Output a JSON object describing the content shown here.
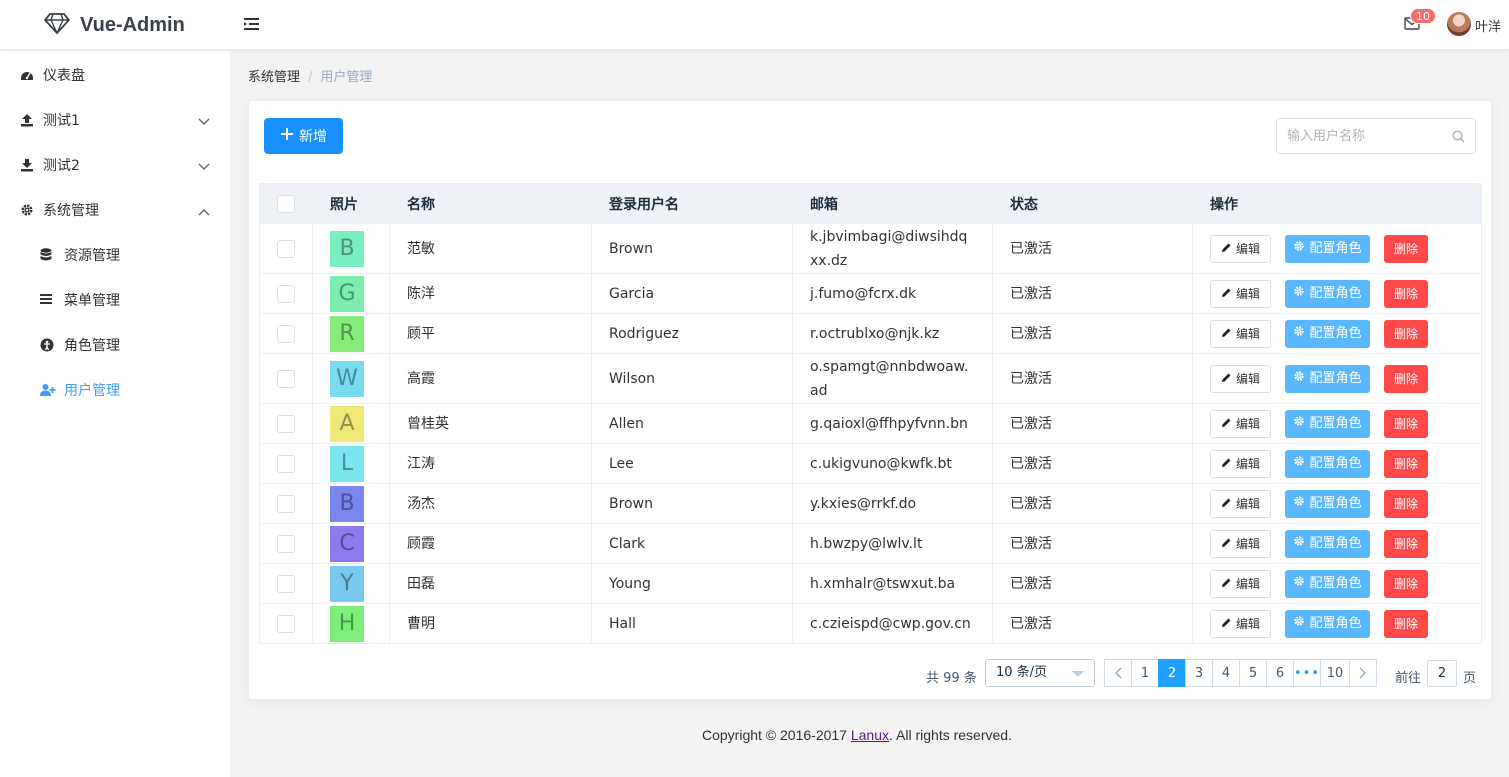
{
  "header": {
    "logo_text": "Vue-Admin",
    "notification_count": "10",
    "username": "叶洋"
  },
  "sidebar": {
    "items": [
      {
        "label": "仪表盘",
        "icon": "dashboard-icon"
      },
      {
        "label": "测试1",
        "icon": "upload-icon",
        "expandable": true
      },
      {
        "label": "测试2",
        "icon": "download-icon",
        "expandable": true
      },
      {
        "label": "系统管理",
        "icon": "gear-icon",
        "expanded": true
      },
      {
        "label": "资源管理",
        "icon": "database-icon"
      },
      {
        "label": "菜单管理",
        "icon": "list-icon"
      },
      {
        "label": "角色管理",
        "icon": "role-icon"
      },
      {
        "label": "用户管理",
        "icon": "user-plus-icon",
        "active": true
      }
    ]
  },
  "breadcrumb": {
    "parent": "系统管理",
    "separator": "/",
    "current": "用户管理"
  },
  "toolbar": {
    "add_label": "新增",
    "search_placeholder": "输入用户名称"
  },
  "table": {
    "columns": [
      "照片",
      "名称",
      "登录用户名",
      "邮箱",
      "状态",
      "操作"
    ],
    "rows": [
      {
        "photo": "B",
        "color": "#79eec0",
        "name": "范敏",
        "login": "Brown",
        "email": "k.jbvimbagi@diwsihdqxx.dz",
        "status": "已激活"
      },
      {
        "photo": "G",
        "color": "#79eeb0",
        "name": "陈洋",
        "login": "Garcia",
        "email": "j.fumo@fcrx.dk",
        "status": "已激活"
      },
      {
        "photo": "R",
        "color": "#86ec79",
        "name": "顾平",
        "login": "Rodriguez",
        "email": "r.octrublxo@njk.kz",
        "status": "已激活"
      },
      {
        "photo": "W",
        "color": "#79dbee",
        "name": "高霞",
        "login": "Wilson",
        "email": "o.spamgt@nnbdwoaw.ad",
        "status": "已激活"
      },
      {
        "photo": "A",
        "color": "#eee879",
        "name": "曾桂英",
        "login": "Allen",
        "email": "g.qaioxl@ffhpyfvnn.bn",
        "status": "已激活"
      },
      {
        "photo": "L",
        "color": "#79e6ee",
        "name": "江涛",
        "login": "Lee",
        "email": "c.ukigvuno@kwfk.bt",
        "status": "已激活"
      },
      {
        "photo": "B",
        "color": "#7986ee",
        "name": "汤杰",
        "login": "Brown",
        "email": "y.kxies@rrkf.do",
        "status": "已激活"
      },
      {
        "photo": "C",
        "color": "#8f79ee",
        "name": "顾霞",
        "login": "Clark",
        "email": "h.bwzpy@lwlv.lt",
        "status": "已激活"
      },
      {
        "photo": "Y",
        "color": "#79c9ee",
        "name": "田磊",
        "login": "Young",
        "email": "h.xmhalr@tswxut.ba",
        "status": "已激活"
      },
      {
        "photo": "H",
        "color": "#7dee79",
        "name": "曹明",
        "login": "Hall",
        "email": "c.czieispd@cwp.gov.cn",
        "status": "已激活"
      }
    ],
    "actions": {
      "edit": "编辑",
      "role": "配置角色",
      "delete": "删除"
    }
  },
  "pagination": {
    "total_text": "共 99 条",
    "page_size": "10 条/页",
    "pages": [
      "1",
      "2",
      "3",
      "4",
      "5",
      "6",
      "•••",
      "10"
    ],
    "current_page": "2",
    "goto_label": "前往",
    "goto_value": "2",
    "goto_suffix": "页"
  },
  "footer": {
    "prefix": "Copyright © 2016-2017 ",
    "link": "Lanux",
    "suffix": ". All rights reserved."
  },
  "colors": {
    "primary": "#1890ff",
    "role_button": "#58b7ff",
    "delete_button": "#ff4949",
    "active_menu": "#409eff"
  }
}
